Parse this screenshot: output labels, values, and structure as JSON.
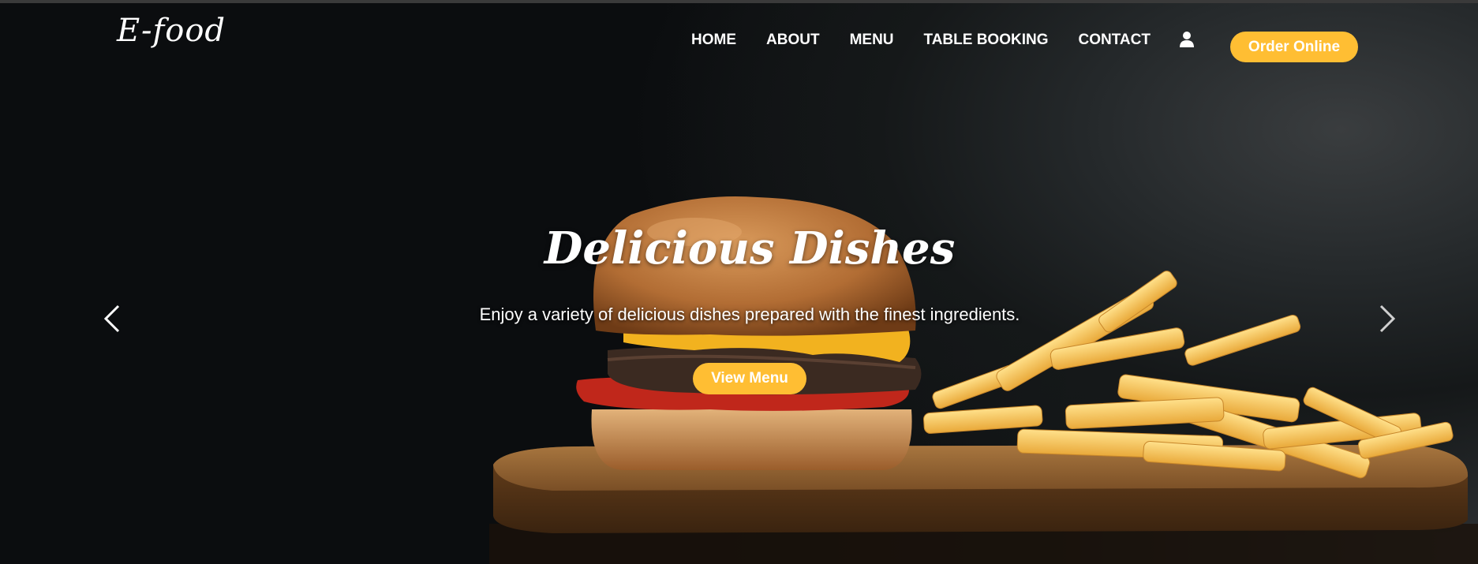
{
  "brand": {
    "logo_text": "E-food"
  },
  "nav": {
    "items": [
      "HOME",
      "ABOUT",
      "MENU",
      "TABLE BOOKING",
      "CONTACT"
    ],
    "user_icon": "user-icon",
    "order_label": "Order Online"
  },
  "hero": {
    "title": "Delicious Dishes",
    "subtitle": "Enjoy a variety of delicious dishes prepared with the finest ingredients.",
    "cta_label": "View Menu",
    "prev_icon": "chevron-left-icon",
    "next_icon": "chevron-right-icon"
  },
  "colors": {
    "accent": "#ffbe33",
    "background": "#0b0d0f",
    "text": "#ffffff"
  }
}
